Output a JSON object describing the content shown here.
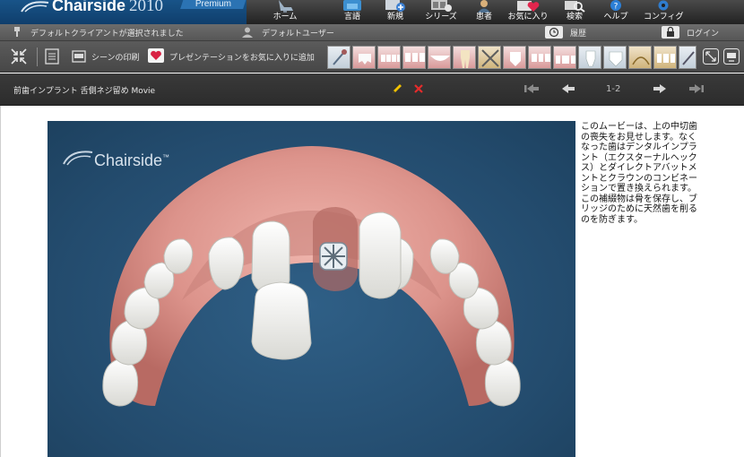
{
  "app": {
    "brand": "Chairside",
    "year": "2010",
    "edition": "Premium"
  },
  "nav": [
    {
      "key": "home",
      "label": "ホーム",
      "icon": "dentist-chair-icon"
    },
    {
      "key": "language",
      "label": "言語",
      "icon": "language-globe-icon"
    },
    {
      "key": "new",
      "label": "新規",
      "icon": "new-presentation-icon"
    },
    {
      "key": "series",
      "label": "シリーズ",
      "icon": "film-series-icon"
    },
    {
      "key": "patient",
      "label": "患者",
      "icon": "patient-icon"
    },
    {
      "key": "favorites",
      "label": "お気に入り",
      "icon": "heart-icon"
    },
    {
      "key": "search",
      "label": "検索",
      "icon": "search-icon"
    },
    {
      "key": "help",
      "label": "ヘルプ",
      "icon": "help-icon"
    },
    {
      "key": "config",
      "label": "コンフィグ",
      "icon": "gear-icon"
    }
  ],
  "status": {
    "client": "デフォルトクライアントが選択されました",
    "user": "デフォルトユーザー",
    "history": "履歴",
    "login": "ログイン"
  },
  "tools": {
    "print": "シーンの印刷",
    "add_favorite": "プレゼンテーションをお気に入りに追加"
  },
  "title": {
    "text": "前歯インプラント 舌側ネジ留め Movie",
    "page": "1-2"
  },
  "video": {
    "watermark": "Chairside",
    "trademark": "™"
  },
  "description": "このムービーは、上の中切歯の喪失をお見せします。なくなった歯はデンタルインプラント（エクスターナルヘックス）とダイレクトアバットメントとクラウンのコンビネーションで置き換えられます。この補綴物は骨を保存し、ブリッジのために天然歯を削るのを防ぎます。",
  "colors": {
    "accent_blue": "#1d5f97",
    "video_bg": "#234b6d",
    "gum": "#d98f88",
    "tooth": "#f4f4f0",
    "edit_yellow": "#f2c200",
    "delete_red": "#e52b2b"
  }
}
